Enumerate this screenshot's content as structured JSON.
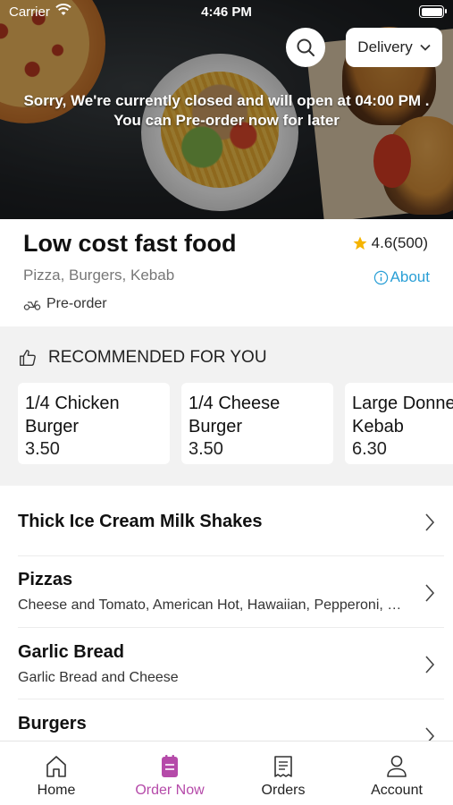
{
  "status_bar": {
    "carrier": "Carrier",
    "time": "4:46 PM"
  },
  "header": {
    "delivery_label": "Delivery",
    "closed_line1": "Sorry, We're currently closed and will open at 04:00 PM .",
    "closed_line2": "You can Pre-order now for later"
  },
  "restaurant": {
    "name": "Low cost fast food",
    "rating": "4.6(500)",
    "cuisine": "Pizza, Burgers, Kebab",
    "about_label": "About",
    "preorder_label": "Pre-order"
  },
  "recommended": {
    "heading": "RECOMMENDED FOR YOU",
    "items": [
      {
        "line1": "1/4 Chicken",
        "line2": "Burger",
        "price": "3.50"
      },
      {
        "line1": "1/4 Cheese",
        "line2": "Burger",
        "price": "3.50"
      },
      {
        "line1": "Large Donne",
        "line2": "Kebab",
        "price": "6.30"
      }
    ]
  },
  "menu": [
    {
      "title": "Thick Ice Cream Milk Shakes",
      "desc": ""
    },
    {
      "title": "Pizzas",
      "desc": "Cheese and Tomato, American Hot, Hawaiian, Pepperoni, Vegetarian"
    },
    {
      "title": "Garlic Bread",
      "desc": "Garlic Bread and Cheese"
    },
    {
      "title": "Burgers",
      "desc": ""
    }
  ],
  "tabs": [
    {
      "label": "Home",
      "icon": "home-icon"
    },
    {
      "label": "Order Now",
      "icon": "order-now-icon"
    },
    {
      "label": "Orders",
      "icon": "orders-icon"
    },
    {
      "label": "Account",
      "icon": "account-icon"
    }
  ],
  "colors": {
    "accent": "#b54aa9",
    "link": "#2a9fd6",
    "star": "#f5b400"
  }
}
